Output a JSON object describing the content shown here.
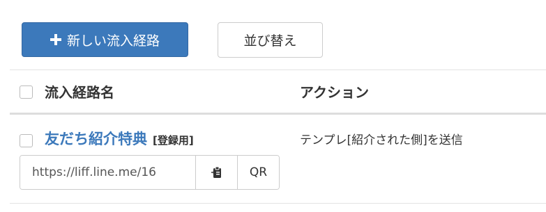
{
  "toolbar": {
    "new_route_label": "新しい流入経路",
    "sort_label": "並び替え",
    "plus_icon": "plus-icon"
  },
  "table": {
    "header": {
      "name": "流入経路名",
      "action": "アクション"
    },
    "rows": [
      {
        "name": "友だち紹介特典",
        "tag": "[登録用]",
        "url": "https://liff.line.me/16",
        "copy_icon": "clipboard-copy-icon",
        "qr_label": "QR",
        "action": "テンプレ[紹介された側]を送信"
      }
    ]
  },
  "colors": {
    "primary": "#3c79bb",
    "text": "#333333",
    "border": "#cccccc"
  }
}
